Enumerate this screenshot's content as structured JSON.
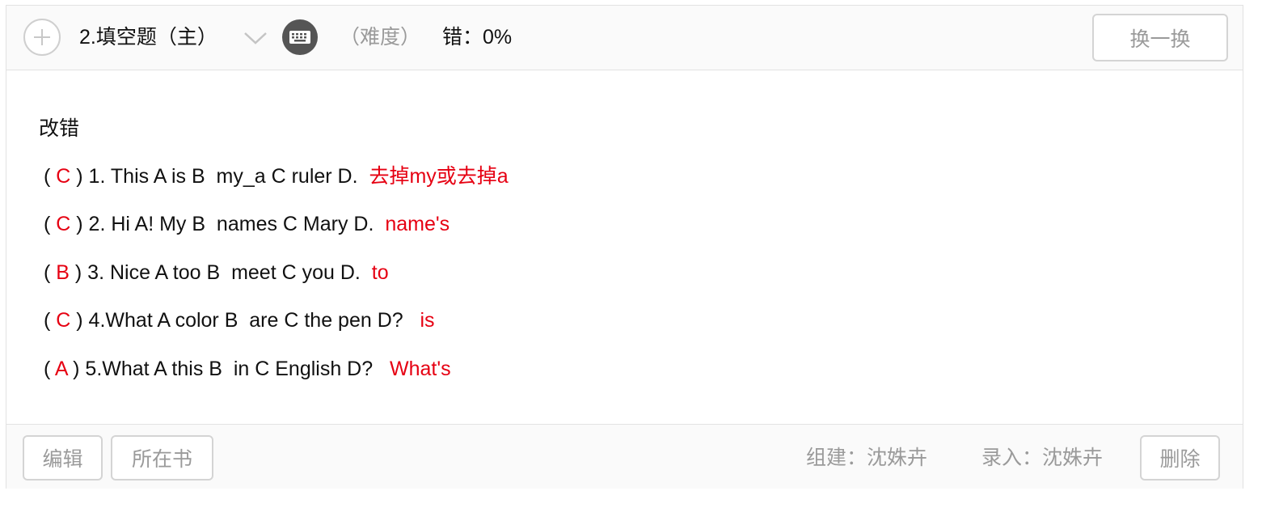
{
  "header": {
    "title": "2.填空题（主）",
    "difficulty": "（难度）",
    "error_rate": "错：0%",
    "swap_label": "换一换"
  },
  "question": {
    "prompt": "改错",
    "items": [
      {
        "prefix": "( ",
        "answer": "C",
        "text": " ) 1. This A is B  my_a C ruler D.  ",
        "correction": "去掉my或去掉a"
      },
      {
        "prefix": "( ",
        "answer": "C",
        "text": " ) 2. Hi A! My B  names C Mary D.  ",
        "correction": "name's"
      },
      {
        "prefix": "( ",
        "answer": "B",
        "text": " ) 3. Nice A too B  meet C you D.  ",
        "correction": "to"
      },
      {
        "prefix": "( ",
        "answer": "C",
        "text": " ) 4.What A color B  are C the pen D?   ",
        "correction": "is"
      },
      {
        "prefix": "( ",
        "answer": "A",
        "text": " ) 5.What A this B  in C English D?   ",
        "correction": "What's"
      }
    ]
  },
  "footer": {
    "edit_label": "编辑",
    "book_label": "所在书",
    "builder": "组建：沈姝卉",
    "entry": "录入：沈姝卉",
    "delete_label": "删除"
  },
  "colors": {
    "answer": "#e60012",
    "muted": "#9a9a9a",
    "keyboard_bg": "#555555"
  },
  "icons": {
    "add": "plus-circle-icon",
    "expand": "chevron-down-icon",
    "keyboard": "keyboard-icon"
  }
}
